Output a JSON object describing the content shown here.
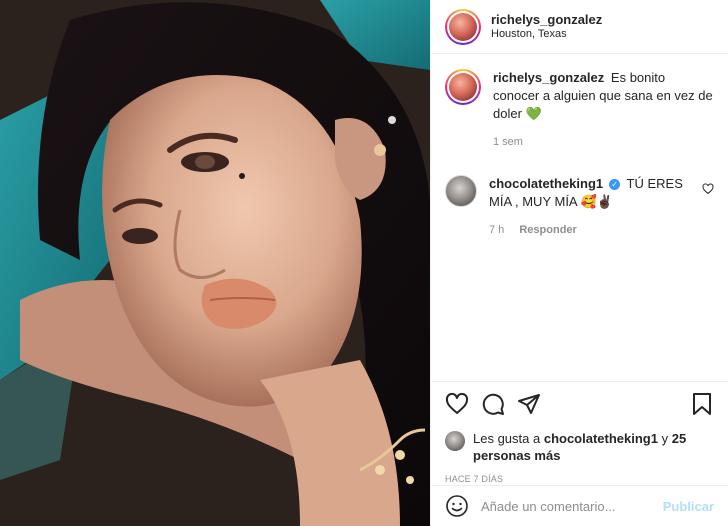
{
  "post": {
    "photo_alt": "selfie photo",
    "author": {
      "username": "richelys_gonzalez",
      "location": "Houston, Texas"
    }
  },
  "caption": {
    "username": "richelys_gonzalez",
    "text": "Es bonito conocer a alguien que sana en vez de doler",
    "emoji": "💚",
    "time": "1 sem"
  },
  "comments": [
    {
      "username": "chocolatetheking1",
      "verified": true,
      "text": "TÚ ERES MÍA , MUY MÍA",
      "emoji": "🥰✌🏿",
      "time": "7 h",
      "reply_label": "Responder"
    }
  ],
  "likes": {
    "prefix": "Les gusta a",
    "user": "chocolatetheking1",
    "conj": "y",
    "others": "25 personas más"
  },
  "timestamp": "HACE 7 DÍAS",
  "composer": {
    "placeholder": "Añade un comentario...",
    "publish_label": "Publicar"
  },
  "icons": {
    "like": "heart-icon",
    "comment": "comment-icon",
    "share": "paper-plane-icon",
    "save": "bookmark-icon",
    "emoji": "smiley-icon",
    "comment_like": "heart-icon"
  },
  "colors": {
    "verified": "#3897f0",
    "publish_disabled": "#b2dffc",
    "muted": "#8e8e8e",
    "caption_heart": "#2ecc40"
  }
}
